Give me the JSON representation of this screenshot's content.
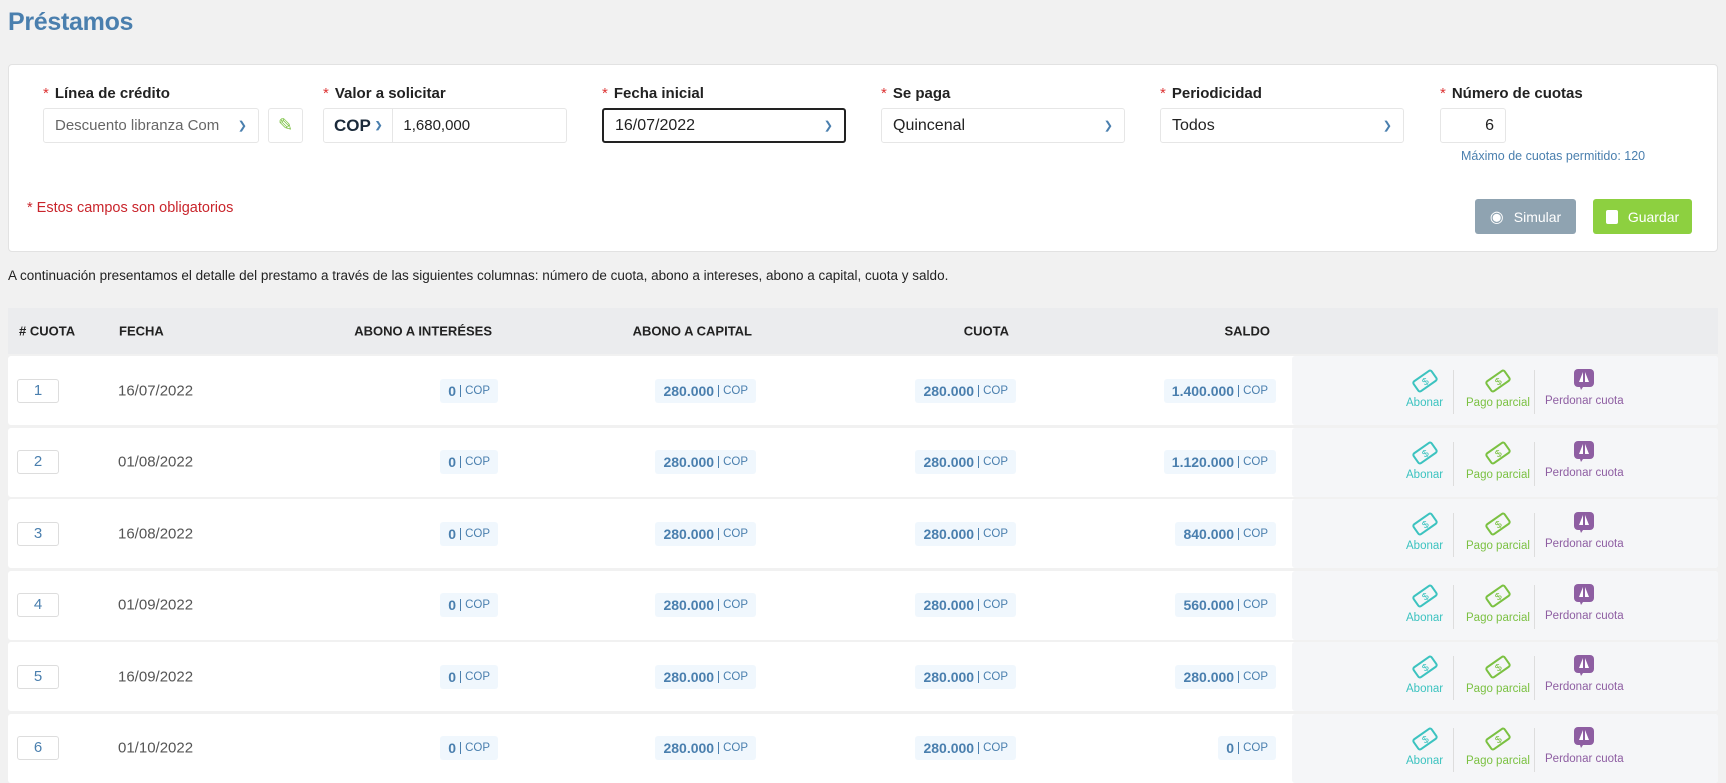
{
  "page": {
    "title": "Préstamos"
  },
  "form": {
    "linea": {
      "label": "Línea de crédito",
      "value": "Descuento libranza Com"
    },
    "valor": {
      "label": "Valor a solicitar",
      "currency": "COP",
      "value": "1,680,000"
    },
    "fecha": {
      "label": "Fecha inicial",
      "value": "16/07/2022"
    },
    "se_paga": {
      "label": "Se paga",
      "value": "Quincenal"
    },
    "periodicidad": {
      "label": "Periodicidad",
      "value": "Todos"
    },
    "cuotas": {
      "label": "Número de cuotas",
      "value": "6",
      "hint": "Máximo de cuotas permitido: 120"
    },
    "required_note": "* Estos campos son obligatorios",
    "simular_label": "Simular",
    "guardar_label": "Guardar",
    "required_mark": "*"
  },
  "description": "A continuación presentamos el detalle del prestamo a través de las siguientes columnas: número de cuota, abono a intereses, abono a capital, cuota y saldo.",
  "table": {
    "headers": [
      "# CUOTA",
      "FECHA",
      "ABONO A INTERÉSES",
      "ABONO A CAPITAL",
      "CUOTA",
      "SALDO"
    ],
    "currency": "COP",
    "actions": {
      "abonar": "Abonar",
      "pago_parcial": "Pago parcial",
      "perdonar": "Perdonar cuota"
    },
    "rows": [
      {
        "n": "1",
        "fecha": "16/07/2022",
        "interes": "0",
        "capital": "280.000",
        "cuota": "280.000",
        "saldo": "1.400.000"
      },
      {
        "n": "2",
        "fecha": "01/08/2022",
        "interes": "0",
        "capital": "280.000",
        "cuota": "280.000",
        "saldo": "1.120.000"
      },
      {
        "n": "3",
        "fecha": "16/08/2022",
        "interes": "0",
        "capital": "280.000",
        "cuota": "280.000",
        "saldo": "840.000"
      },
      {
        "n": "4",
        "fecha": "01/09/2022",
        "interes": "0",
        "capital": "280.000",
        "cuota": "280.000",
        "saldo": "560.000"
      },
      {
        "n": "5",
        "fecha": "16/09/2022",
        "interes": "0",
        "capital": "280.000",
        "cuota": "280.000",
        "saldo": "280.000"
      },
      {
        "n": "6",
        "fecha": "01/10/2022",
        "interes": "0",
        "capital": "280.000",
        "cuota": "280.000",
        "saldo": "0"
      }
    ]
  },
  "colors": {
    "accent": "#4a7fae",
    "abonar": "#3cc3c0",
    "pago_parcial": "#7bc142",
    "perdonar": "#8e5ea2",
    "guardar": "#8dd040",
    "simular": "#8fa3b1",
    "required": "#c9252c"
  }
}
